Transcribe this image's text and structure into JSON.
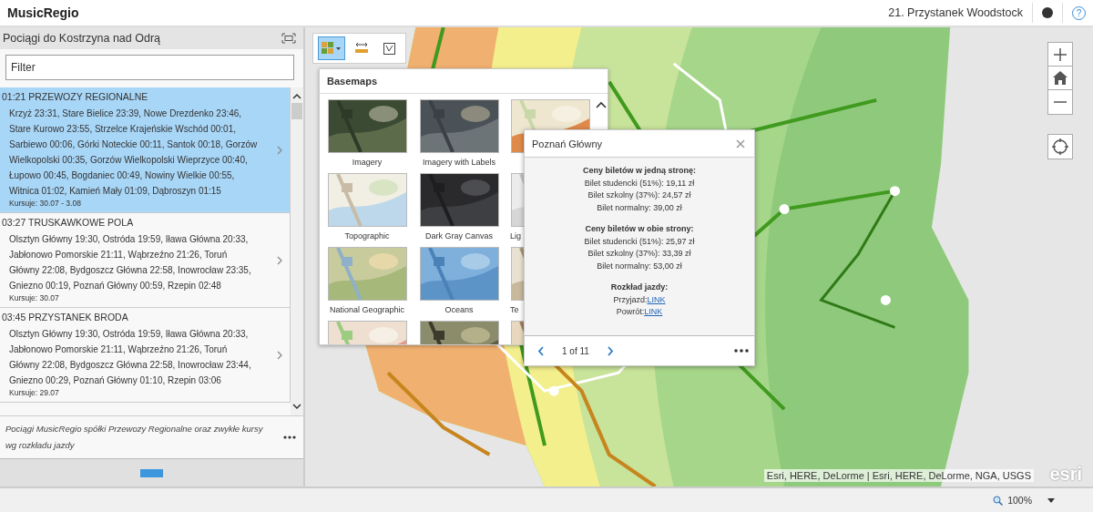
{
  "app": {
    "title": "MusicRegio",
    "event": "21. Przystanek Woodstock",
    "help": "?"
  },
  "panel": {
    "title": "Pociągi do Kostrzyna nad Odrą",
    "filter": {
      "placeholder": "Filter"
    },
    "items": [
      {
        "title": "01:21 PRZEWOZY REGIONALNE",
        "stops": "Krzyż 23:31, Stare Bielice 23:39, Nowe Drezdenko 23:46, Stare Kurowo 23:55, Strzelce Krajeńskie Wschód 00:01, Sarbiewo 00:06, Górki Noteckie 00:11, Santok 00:18, Gorzów Wielkopolski 00:35, Gorzów Wielkopolski Wieprzyce 00:40, Łupowo 00:45, Bogdaniec 00:49, Nowiny Wielkie 00:55, Witnica 01:02, Kamień Mały 01:09, Dąbroszyn 01:15",
        "dates": "Kursuje: 30.07 - 3.08",
        "selected": true
      },
      {
        "title": "03:27 TRUSKAWKOWE POLA",
        "stops": "Olsztyn Główny 19:30, Ostróda 19:59, Iława Główna 20:33, Jabłonowo Pomorskie 21:11, Wąbrzeźno 21:26, Toruń Główny 22:08, Bydgoszcz Główna 22:58, Inowrocław 23:35, Gniezno 00:19, Poznań Główny 00:59, Rzepin 02:48",
        "dates": "Kursuje: 30.07",
        "selected": false
      },
      {
        "title": "03:45 PRZYSTANEK BRODA",
        "stops": "Olsztyn Główny 19:30, Ostróda 19:59, Iława Główna 20:33, Jabłonowo Pomorskie 21:11, Wąbrzeźno 21:26, Toruń Główny 22:08, Bydgoszcz Główna 22:58, Inowrocław 23:44, Gniezno 00:29, Poznań Główny 01:10, Rzepin 03:06",
        "dates": "Kursuje: 29.07",
        "selected": false
      }
    ],
    "footer": "Pociągi MusicRegio spółki Przewozy Regionalne oraz zwykłe kursy wg rozkładu jazdy"
  },
  "tools": [
    {
      "kind": "basemap",
      "selected": true
    },
    {
      "kind": "measure",
      "selected": false
    },
    {
      "kind": "legend",
      "selected": false
    }
  ],
  "basemaps": {
    "title": "Basemaps",
    "items": [
      {
        "kind": "thumbnail",
        "label": "Imagery"
      },
      {
        "kind": "thumbnail",
        "label": "Imagery with Labels"
      },
      {
        "kind": "thumbnail"
      },
      {
        "kind": "thumbnail",
        "label": "Topographic"
      },
      {
        "kind": "thumbnail",
        "label": "Dark Gray Canvas"
      },
      {
        "kind": "thumbnail",
        "label": "Lig"
      },
      {
        "kind": "thumbnail",
        "label": "National Geographic"
      },
      {
        "kind": "thumbnail",
        "label": "Oceans"
      },
      {
        "kind": "thumbnail",
        "label": "Te"
      },
      {
        "kind": "thumbnail"
      },
      {
        "kind": "thumbnail"
      },
      {
        "kind": "thumbnail"
      }
    ]
  },
  "popup": {
    "title": "Poznań Główny",
    "sections": [
      {
        "heading": "Ceny biletów w jedną stronę:",
        "lines": [
          "Bilet studencki (51%): 19,11 zł",
          "Bilet szkolny (37%): 24,57 zł",
          "Bilet normalny: 39,00 zł"
        ]
      },
      {
        "heading": "Ceny biletów w obie strony:",
        "lines": [
          "Bilet studencki (51%): 25,97 zł",
          "Bilet szkolny (37%): 33,39 zł",
          "Bilet normalny: 53,00 zł"
        ]
      },
      {
        "heading": "Rozkład jazdy:",
        "links": [
          {
            "label": "Przyjazd:",
            "link": "LINK"
          },
          {
            "label": "Powrót:",
            "link": "LINK"
          }
        ]
      }
    ],
    "pager": "1 of 11"
  },
  "map": {
    "attribution": "Esri, HERE, DeLorme | Esri, HERE, DeLorme, NGA, USGS",
    "logo": "esri"
  },
  "status_bar": {
    "zoom": "100%"
  }
}
